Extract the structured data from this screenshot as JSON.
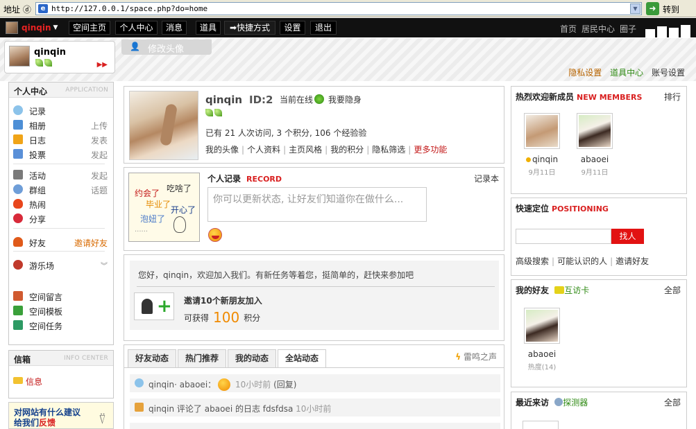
{
  "browser": {
    "address_label": "地址 ⓓ",
    "url": "http://127.0.0.1/space.php?do=home",
    "go_label": "转到"
  },
  "topnav": {
    "brand_name": "qinqin",
    "items": [
      "空间主页",
      "个人中心",
      "消息",
      "道具",
      "快捷方式",
      "设置",
      "退出"
    ],
    "right_links": [
      "首页",
      "居民中心",
      "圈子"
    ]
  },
  "user": {
    "name": "qinqin",
    "edit_avatar": "修改头像",
    "links": [
      "隐私设置",
      "道具中心",
      "账号设置"
    ]
  },
  "left_menu": {
    "title": "个人中心",
    "title_en": "APPLICATION",
    "items": [
      {
        "label": "记录",
        "action": ""
      },
      {
        "label": "相册",
        "action": "上传"
      },
      {
        "label": "日志",
        "action": "发表"
      },
      {
        "label": "投票",
        "action": "发起"
      },
      {
        "label": "活动",
        "action": "发起"
      },
      {
        "label": "群组",
        "action": "话题"
      },
      {
        "label": "热闹",
        "action": ""
      },
      {
        "label": "分享",
        "action": ""
      },
      {
        "label": "好友",
        "action": "邀请好友"
      },
      {
        "label": "游乐场",
        "action": ""
      },
      {
        "label": "空间留言",
        "action": ""
      },
      {
        "label": "空间模板",
        "action": ""
      },
      {
        "label": "空间任务",
        "action": ""
      }
    ]
  },
  "inbox": {
    "title": "信箱",
    "title_en": "INFO CENTER",
    "message": "信息"
  },
  "feedback": {
    "line1": "对网站有什么建议",
    "line2_prefix": "给我们",
    "line2_red": "反馈"
  },
  "profile": {
    "name": "qinqin",
    "id": "ID:2",
    "online": "当前在线",
    "hide": "我要隐身",
    "stats": "已有  21 人次访问, 3 个积分, 106 个经验验",
    "links": [
      "我的头像",
      "个人资料",
      "主页风格",
      "我的积分",
      "隐私筛选"
    ],
    "more": "更多功能"
  },
  "record": {
    "title": "个人记录",
    "title_en": "RECORD",
    "book": "记录本",
    "placeholder": "你可以更新状态, 让好友们知道你在做什么...",
    "doodle": [
      "约会了",
      "吃啥了",
      "毕业了",
      "开心了",
      "泡妞了",
      "......"
    ]
  },
  "welcome": {
    "text": "您好，qinqin，欢迎加入我们。有新任务等着您，挺简单的，赶快来参加吧",
    "invite_title": "邀请10个新朋友加入",
    "reward_prefix": "可获得",
    "reward_value": "100",
    "reward_unit": "积分"
  },
  "feed": {
    "tabs": [
      "好友动态",
      "热门推荐",
      "我的动态",
      "全站动态"
    ],
    "thunder": "雷鸣之声",
    "rows": [
      {
        "a": "qinqin",
        "b": "abaoei",
        "time": "10小时前",
        "reply": "(回复)"
      },
      {
        "a": "qinqin 评论了",
        "b": "abaoei 的日志  fdsfdsa",
        "time": "10小时前"
      }
    ]
  },
  "new_members": {
    "title": "热烈欢迎新成员",
    "title_en": "NEW MEMBERS",
    "rank": "排行",
    "members": [
      {
        "name": "qinqin",
        "date": "9月11日"
      },
      {
        "name": "abaoei",
        "date": "9月11日"
      }
    ]
  },
  "positioning": {
    "title": "快速定位",
    "title_en": "POSITIONING",
    "button": "找人",
    "links": [
      "高级搜索",
      "可能认识的人",
      "邀请好友"
    ]
  },
  "friends": {
    "title": "我的好友",
    "card": "互访卡",
    "all": "全部",
    "items": [
      {
        "name": "abaoei",
        "meta": "热度(14)"
      }
    ]
  },
  "visitors": {
    "title": "最近来访",
    "detector": "探测器",
    "all": "全部"
  }
}
